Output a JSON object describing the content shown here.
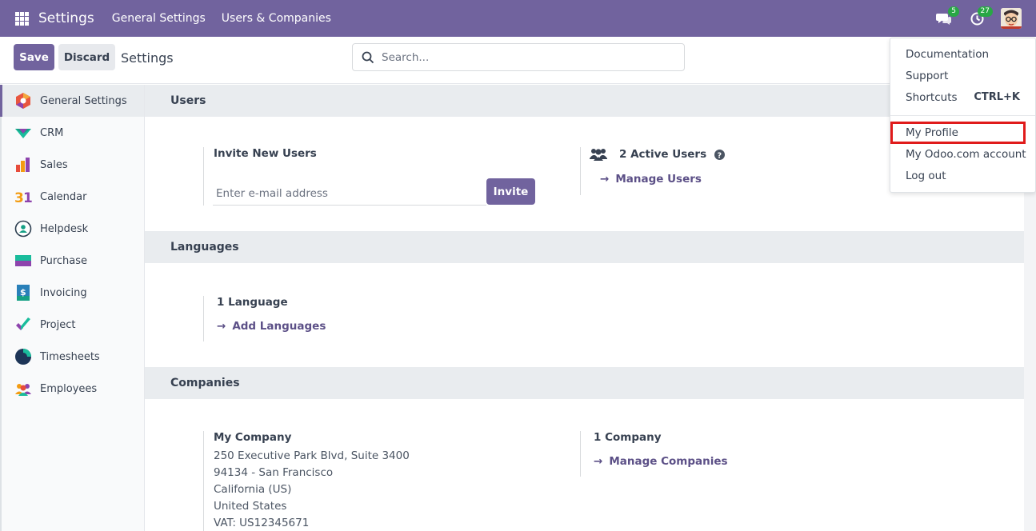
{
  "navbar": {
    "app_title": "Settings",
    "menus": [
      "General Settings",
      "Users & Companies"
    ],
    "messages_count": "5",
    "activities_count": "27"
  },
  "control_panel": {
    "save_label": "Save",
    "discard_label": "Discard",
    "title": "Settings",
    "search_placeholder": "Search..."
  },
  "sidebar": {
    "items": [
      {
        "label": "General Settings",
        "icon": "general-settings-icon"
      },
      {
        "label": "CRM",
        "icon": "crm-icon"
      },
      {
        "label": "Sales",
        "icon": "sales-icon"
      },
      {
        "label": "Calendar",
        "icon": "calendar-icon"
      },
      {
        "label": "Helpdesk",
        "icon": "helpdesk-icon"
      },
      {
        "label": "Purchase",
        "icon": "purchase-icon"
      },
      {
        "label": "Invoicing",
        "icon": "invoicing-icon"
      },
      {
        "label": "Project",
        "icon": "project-icon"
      },
      {
        "label": "Timesheets",
        "icon": "timesheets-icon"
      },
      {
        "label": "Employees",
        "icon": "employees-icon"
      }
    ]
  },
  "users": {
    "header": "Users",
    "invite_label": "Invite New Users",
    "email_placeholder": "Enter e-mail address",
    "invite_button": "Invite",
    "active_users": "2 Active Users",
    "manage_users": "Manage Users"
  },
  "languages": {
    "header": "Languages",
    "count": "1 Language",
    "add_link": "Add Languages"
  },
  "companies": {
    "header": "Companies",
    "company_name": "My Company",
    "address_lines": [
      "250 Executive Park Blvd, Suite 3400",
      "94134 - San Francisco",
      "California (US)",
      "United States",
      "VAT:  US12345671"
    ],
    "count": "1 Company",
    "manage_link": "Manage Companies"
  },
  "user_menu": {
    "documentation": "Documentation",
    "support": "Support",
    "shortcuts": "Shortcuts",
    "shortcuts_key": "CTRL+K",
    "my_profile": "My Profile",
    "odoo_account": "My Odoo.com account",
    "logout": "Log out"
  },
  "colors": {
    "brand": "#71639e",
    "badge": "#28a745",
    "highlight": "#e01b1b"
  }
}
